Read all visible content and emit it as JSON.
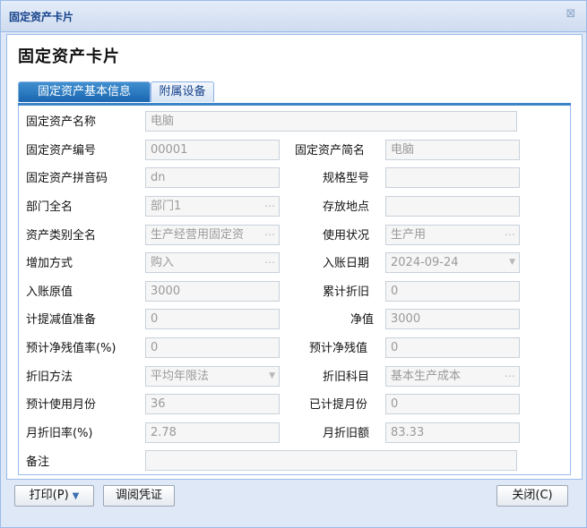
{
  "window": {
    "title": "固定资产卡片",
    "close_icon": "close-icon"
  },
  "heading": "固定资产卡片",
  "tabs": [
    {
      "label": "固定资产基本信息"
    },
    {
      "label": "附属设备"
    }
  ],
  "fields": {
    "name": {
      "label": "固定资产名称",
      "value": "电脑"
    },
    "code": {
      "label": "固定资产编号",
      "value": "00001"
    },
    "short": {
      "label": "固定资产简名",
      "value": "电脑"
    },
    "pinyin": {
      "label": "固定资产拼音码",
      "value": "dn"
    },
    "spec": {
      "label": "规格型号",
      "value": ""
    },
    "dept": {
      "label": "部门全名",
      "value": "部门1"
    },
    "place": {
      "label": "存放地点",
      "value": ""
    },
    "category": {
      "label": "资产类别全名",
      "value": "生产经营用固定资"
    },
    "usage": {
      "label": "使用状况",
      "value": "生产用"
    },
    "add": {
      "label": "增加方式",
      "value": "购入"
    },
    "entry_date": {
      "label": "入账日期",
      "value": "2024-09-24"
    },
    "orig": {
      "label": "入账原值",
      "value": "3000"
    },
    "acc_dep": {
      "label": "累计折旧",
      "value": "0"
    },
    "impair": {
      "label": "计提减值准备",
      "value": "0"
    },
    "net": {
      "label": "净值",
      "value": "3000"
    },
    "residual_rate": {
      "label": "预计净残值率(%)",
      "value": "0"
    },
    "residual": {
      "label": "预计净残值",
      "value": "0"
    },
    "method": {
      "label": "折旧方法",
      "value": "平均年限法"
    },
    "dep_account": {
      "label": "折旧科目",
      "value": "基本生产成本"
    },
    "months": {
      "label": "预计使用月份",
      "value": "36"
    },
    "dep_months": {
      "label": "已计提月份",
      "value": "0"
    },
    "monthly_rate": {
      "label": "月折旧率(%)",
      "value": "2.78"
    },
    "monthly_amount": {
      "label": "月折旧额",
      "value": "83.33"
    },
    "remark": {
      "label": "备注",
      "value": ""
    }
  },
  "footer": {
    "print": "打印(P)",
    "voucher": "调阅凭证",
    "close": "关闭(C)"
  }
}
